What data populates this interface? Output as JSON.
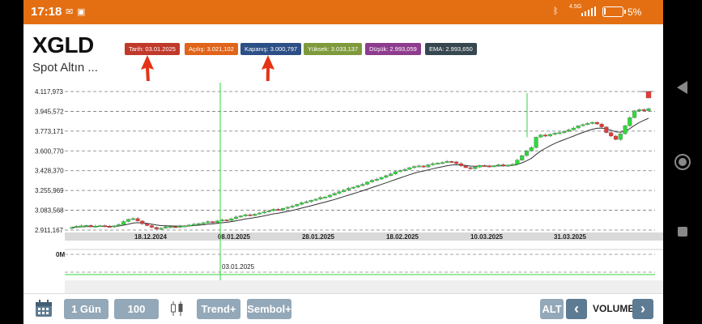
{
  "status_bar": {
    "time": "17:18",
    "network": "4.5G",
    "battery_pct": "5%",
    "battery_level": 0.05
  },
  "header": {
    "symbol": "XGLD",
    "subtitle": "Spot Altın ..."
  },
  "badges": [
    {
      "label": "Tarih: 03.01.2025",
      "color": "#c0392b"
    },
    {
      "label": "Açılış: 3.021,102",
      "color": "#e0641a"
    },
    {
      "label": "Kapanış: 3.000,797",
      "color": "#2c4f86"
    },
    {
      "label": "Yüksek: 3.033,137",
      "color": "#7f9a3c"
    },
    {
      "label": "Düşük: 2.993,059",
      "color": "#8e3c8e"
    },
    {
      "label": "EMA: 2.993,650",
      "color": "#37474f"
    }
  ],
  "chart_data": {
    "type": "candlestick",
    "y_ticks": [
      "4.117,973",
      "3.945,572",
      "3.773,171",
      "3.600,770",
      "3.428,370",
      "3.255,969",
      "3.083,568",
      "2.911,167"
    ],
    "y_tick_values": [
      4117.973,
      3945.572,
      3773.171,
      3600.77,
      3428.37,
      3255.969,
      3083.568,
      2911.167
    ],
    "x_ticks": [
      "18.12.2024",
      "08.01.2025",
      "28.01.2025",
      "18.02.2025",
      "10.03.2025",
      "31.03.2025"
    ],
    "ylim": [
      2870,
      4200
    ],
    "crosshair_date": "03.01.2025",
    "volume_label": "0M",
    "indicator": "EMA",
    "up_color": "#2fd93a",
    "down_color": "#e53935",
    "closes": [
      2935,
      2945,
      2948,
      2952,
      2940,
      2946,
      2950,
      2944,
      2938,
      2948,
      2960,
      2985,
      3005,
      3012,
      2990,
      2965,
      2950,
      2935,
      2920,
      2928,
      2940,
      2942,
      2938,
      2945,
      2948,
      2955,
      2962,
      2968,
      2975,
      2985,
      2975,
      2990,
      3000,
      2995,
      3010,
      3025,
      3035,
      3045,
      3038,
      3050,
      3060,
      3070,
      3080,
      3092,
      3085,
      3100,
      3110,
      3120,
      3135,
      3150,
      3158,
      3170,
      3180,
      3195,
      3200,
      3215,
      3230,
      3245,
      3260,
      3275,
      3285,
      3298,
      3310,
      3330,
      3345,
      3355,
      3370,
      3385,
      3400,
      3420,
      3430,
      3440,
      3455,
      3465,
      3470,
      3460,
      3480,
      3490,
      3495,
      3500,
      3510,
      3505,
      3490,
      3470,
      3455,
      3445,
      3460,
      3475,
      3470,
      3465,
      3472,
      3480,
      3470,
      3478,
      3485,
      3520,
      3560,
      3600,
      3630,
      3720,
      3740,
      3730,
      3745,
      3755,
      3760,
      3770,
      3785,
      3800,
      3820,
      3830,
      3840,
      3850,
      3835,
      3810,
      3760,
      3730,
      3700,
      3750,
      3820,
      3890,
      3950,
      3960,
      3950,
      3970
    ]
  },
  "toolbar": {
    "period_label": "1 Gün",
    "count_label": "100",
    "trend_label": "Trend+",
    "symbol_label": "Sembol+",
    "alt_label": "ALT",
    "prev_label": "‹",
    "indicator_label": "VOLUME",
    "next_label": "›"
  }
}
